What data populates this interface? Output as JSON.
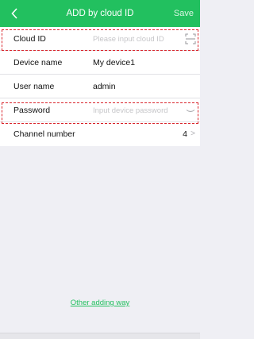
{
  "header": {
    "title": "ADD by cloud ID",
    "save_label": "Save",
    "bg_color": "#22c05f"
  },
  "form": {
    "cloud_id": {
      "label": "Cloud ID",
      "placeholder": "Please input cloud ID",
      "value": ""
    },
    "device_name": {
      "label": "Device name",
      "value": "My device1"
    },
    "user_name": {
      "label": "User name",
      "value": "admin"
    },
    "password": {
      "label": "Password",
      "placeholder": "Input device password",
      "value": ""
    },
    "channel_number": {
      "label": "Channel number",
      "value": "4"
    }
  },
  "footer": {
    "other_adding_way": "Other adding way"
  },
  "icons": {
    "back": "chevron-left-icon",
    "scan": "qr-scan-icon",
    "eye": "eye-closed-icon",
    "chevron": "chevron-right-icon"
  },
  "highlight_color": "#d9232a"
}
